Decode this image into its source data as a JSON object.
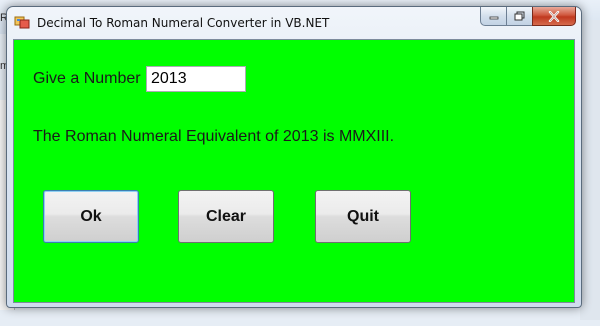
{
  "window": {
    "title": "Decimal To Roman Numeral Converter in VB.NET"
  },
  "form": {
    "number_label": "Give a Number",
    "number_value": "2013",
    "result_text": "The Roman Numeral Equivalent of 2013 is MMXIII.",
    "background_color": "#00ff00"
  },
  "buttons": {
    "ok": "Ok",
    "clear": "Clear",
    "quit": "Quit"
  },
  "background_window": {
    "fragment_1": "Re",
    "fragment_2": "m"
  }
}
